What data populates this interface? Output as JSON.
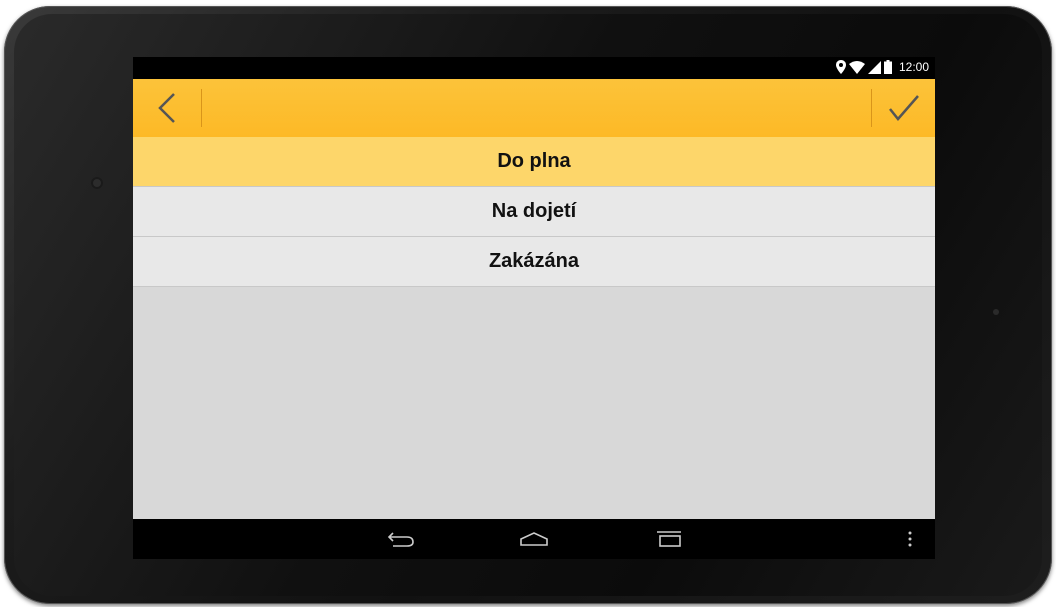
{
  "status_bar": {
    "time": "12:00",
    "icons": [
      "location-icon",
      "wifi-icon",
      "signal-icon",
      "battery-icon"
    ]
  },
  "action_bar": {
    "back_icon": "chevron-left-icon",
    "confirm_icon": "checkmark-icon",
    "color": "#fdbd2e"
  },
  "options": [
    {
      "label": "Do plna",
      "selected": true
    },
    {
      "label": "Na dojetí",
      "selected": false
    },
    {
      "label": "Zakázána",
      "selected": false
    }
  ],
  "nav_bar": {
    "buttons": [
      "back-nav-icon",
      "home-icon",
      "recents-icon",
      "menu-icon"
    ]
  }
}
